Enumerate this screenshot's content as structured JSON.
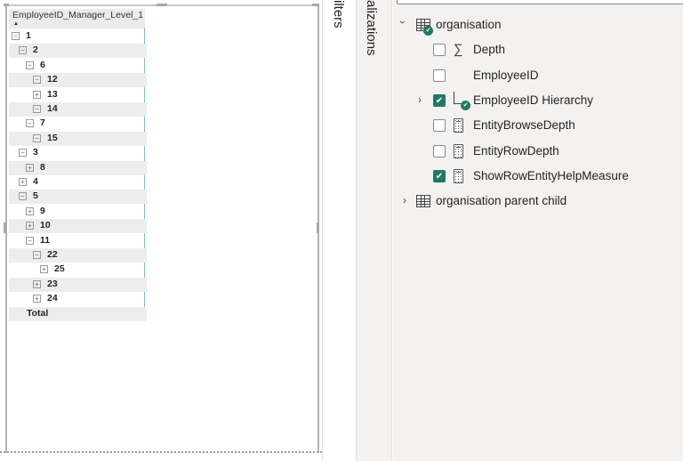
{
  "matrix": {
    "column_header": "EmployeeID_Manager_Level_1",
    "sort_indicator": "▲",
    "rows": [
      {
        "label": "1",
        "depth": 0,
        "state": "collapse"
      },
      {
        "label": "2",
        "depth": 1,
        "state": "collapse"
      },
      {
        "label": "6",
        "depth": 2,
        "state": "collapse"
      },
      {
        "label": "12",
        "depth": 3,
        "state": "collapse"
      },
      {
        "label": "13",
        "depth": 3,
        "state": "expand"
      },
      {
        "label": "14",
        "depth": 3,
        "state": "collapse"
      },
      {
        "label": "7",
        "depth": 2,
        "state": "collapse"
      },
      {
        "label": "15",
        "depth": 3,
        "state": "collapse"
      },
      {
        "label": "3",
        "depth": 1,
        "state": "collapse"
      },
      {
        "label": "8",
        "depth": 2,
        "state": "expand"
      },
      {
        "label": "4",
        "depth": 1,
        "state": "expand"
      },
      {
        "label": "5",
        "depth": 1,
        "state": "collapse"
      },
      {
        "label": "9",
        "depth": 2,
        "state": "expand"
      },
      {
        "label": "10",
        "depth": 2,
        "state": "expand"
      },
      {
        "label": "11",
        "depth": 2,
        "state": "collapse"
      },
      {
        "label": "22",
        "depth": 3,
        "state": "collapse"
      },
      {
        "label": "25",
        "depth": 4,
        "state": "expand"
      },
      {
        "label": "23",
        "depth": 3,
        "state": "expand"
      },
      {
        "label": "24",
        "depth": 3,
        "state": "expand"
      },
      {
        "label": "Total",
        "depth": 1,
        "state": "none"
      }
    ]
  },
  "panes": {
    "filters_label": "ilters",
    "visualizations_label": "alizations"
  },
  "fields": {
    "tables": [
      {
        "name": "organisation",
        "expanded": true,
        "in_use": true,
        "fields": [
          {
            "name": "Depth",
            "icon": "sigma-icon",
            "checked": false
          },
          {
            "name": "EmployeeID",
            "icon": "none",
            "checked": false
          },
          {
            "name": "EmployeeID Hierarchy",
            "icon": "hierarchy-icon",
            "checked": true,
            "expandable": true
          },
          {
            "name": "EntityBrowseDepth",
            "icon": "calculator-icon",
            "checked": false
          },
          {
            "name": "EntityRowDepth",
            "icon": "calculator-icon",
            "checked": false
          },
          {
            "name": "ShowRowEntityHelpMeasure",
            "icon": "calculator-icon",
            "checked": true
          }
        ]
      },
      {
        "name": "organisation parent child",
        "expanded": false,
        "in_use": false
      }
    ]
  },
  "colors": {
    "accent": "#1f7a63",
    "selection_line": "#7ab8f0",
    "pane_bg": "#f3f2f1"
  }
}
